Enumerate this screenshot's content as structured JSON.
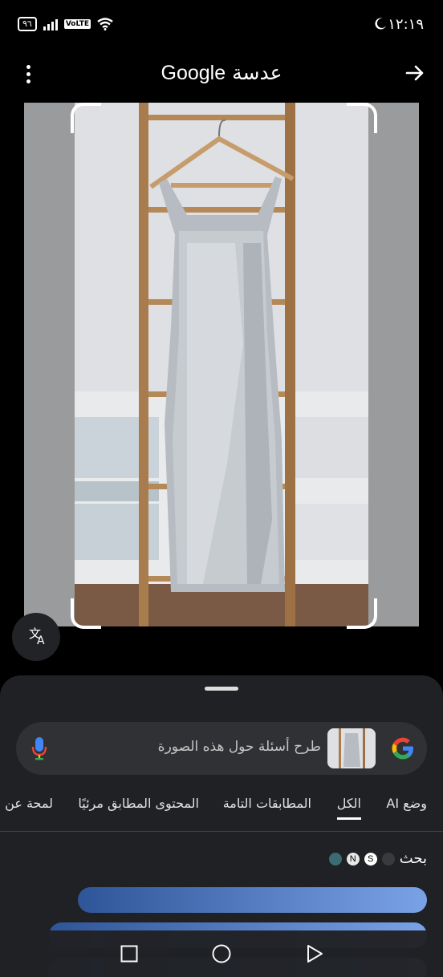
{
  "status_bar": {
    "time": "١٢:١٩",
    "battery": "٩٦",
    "network_label": "VoLTE"
  },
  "header": {
    "title_brand": "Google",
    "title_word": "عدسة"
  },
  "search": {
    "placeholder": "طرح أسئلة حول هذه الصورة"
  },
  "tabs": [
    {
      "label": "وضع AI"
    },
    {
      "label": "الكل"
    },
    {
      "label": "المطابقات التامة"
    },
    {
      "label": "المحتوى المطابق مرئيًا"
    },
    {
      "label": "لمحة عن"
    }
  ],
  "results": {
    "query_word": "بحث",
    "query_badges": [
      "S"
    ]
  },
  "colors": {
    "sheet_bg": "#202124",
    "search_bg": "#303134",
    "skeleton_start": "#2f5599",
    "skeleton_end": "#7aa2e6"
  },
  "icons": {
    "menu": "more-vert-icon",
    "forward": "arrow-right-icon",
    "translate": "translate-icon",
    "mic": "mic-icon",
    "google": "google-g-icon"
  }
}
